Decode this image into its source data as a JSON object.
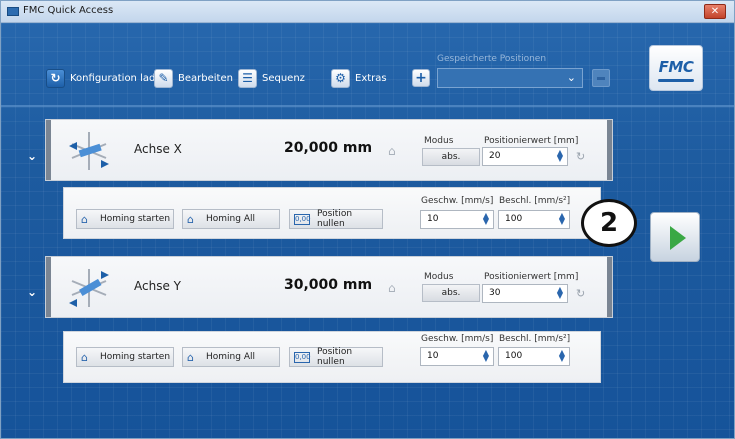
{
  "window": {
    "title": "FMC Quick Access",
    "close": "✕"
  },
  "toolbar": {
    "konfiguration": "Konfiguration laden",
    "bearbeiten": "Bearbeiten",
    "sequenz": "Sequenz",
    "extras": "Extras",
    "gespeicherte_label": "Gespeicherte Positionen",
    "gespeicherte_value": ""
  },
  "logo": {
    "text": "FMC"
  },
  "axes": [
    {
      "name": "Achse X",
      "value": "20,000 mm",
      "modus_label": "Modus",
      "modus_value": "abs.",
      "pos_label": "Positionierwert [mm]",
      "pos_value": "20",
      "speed_label": "Geschw. [mm/s]",
      "speed_value": "10",
      "accel_label": "Beschl. [mm/s²]",
      "accel_value": "100",
      "homing_starten": "Homing starten",
      "homing_all": "Homing All",
      "position_nullen": "Position nullen",
      "zero_icon": "0,00"
    },
    {
      "name": "Achse Y",
      "value": "30,000 mm",
      "modus_label": "Modus",
      "modus_value": "abs.",
      "pos_label": "Positionierwert [mm]",
      "pos_value": "30",
      "speed_label": "Geschw. [mm/s]",
      "speed_value": "10",
      "accel_label": "Beschl. [mm/s²]",
      "accel_value": "100",
      "homing_starten": "Homing starten",
      "homing_all": "Homing All",
      "position_nullen": "Position nullen",
      "zero_icon": "0,00"
    }
  ],
  "step_badge": "2",
  "colors": {
    "background": "#1c5fa3",
    "accent": "#2a66ad",
    "play": "#3aa845"
  }
}
